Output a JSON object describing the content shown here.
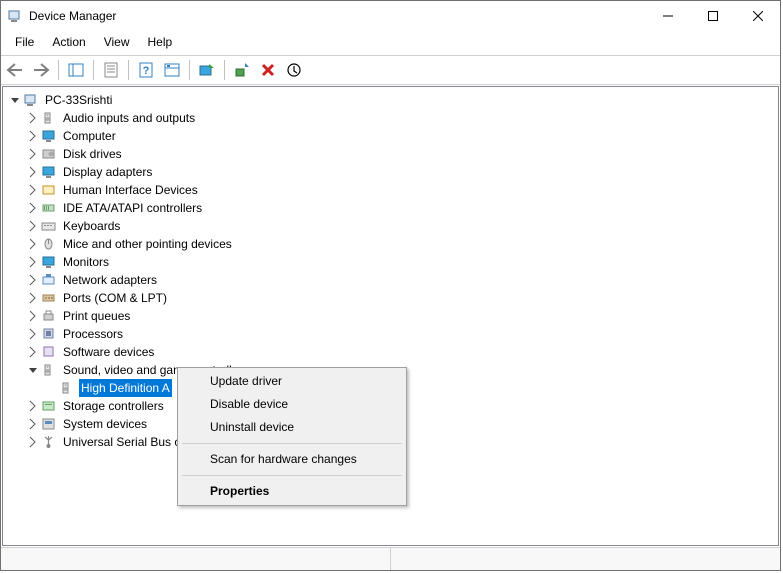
{
  "titlebar": {
    "title": "Device Manager"
  },
  "menubar": {
    "file": "File",
    "action": "Action",
    "view": "View",
    "help": "Help"
  },
  "tree": {
    "root": {
      "label": "PC-33Srishti"
    },
    "nodes": [
      {
        "id": "audio",
        "label": "Audio inputs and outputs",
        "icon": "speaker"
      },
      {
        "id": "computer",
        "label": "Computer",
        "icon": "monitor"
      },
      {
        "id": "disk",
        "label": "Disk drives",
        "icon": "disk"
      },
      {
        "id": "display",
        "label": "Display adapters",
        "icon": "monitor"
      },
      {
        "id": "hid",
        "label": "Human Interface Devices",
        "icon": "hid"
      },
      {
        "id": "ide",
        "label": "IDE ATA/ATAPI controllers",
        "icon": "ide"
      },
      {
        "id": "keyboards",
        "label": "Keyboards",
        "icon": "keyboard"
      },
      {
        "id": "mice",
        "label": "Mice and other pointing devices",
        "icon": "mouse"
      },
      {
        "id": "monitors",
        "label": "Monitors",
        "icon": "monitor"
      },
      {
        "id": "network",
        "label": "Network adapters",
        "icon": "network"
      },
      {
        "id": "ports",
        "label": "Ports (COM & LPT)",
        "icon": "port"
      },
      {
        "id": "printq",
        "label": "Print queues",
        "icon": "printer"
      },
      {
        "id": "proc",
        "label": "Processors",
        "icon": "cpu"
      },
      {
        "id": "softdev",
        "label": "Software devices",
        "icon": "software"
      },
      {
        "id": "sound",
        "label": "Sound, video and game controllers",
        "icon": "speaker",
        "expanded": true,
        "children": [
          {
            "id": "hda",
            "label": "High Definition A",
            "icon": "speaker",
            "selected": true
          }
        ]
      },
      {
        "id": "storage",
        "label": "Storage controllers",
        "icon": "storage"
      },
      {
        "id": "system",
        "label": "System devices",
        "icon": "system"
      },
      {
        "id": "usb",
        "label": "Universal Serial Bus c",
        "icon": "usb"
      }
    ]
  },
  "context_menu": {
    "update": "Update driver",
    "disable": "Disable device",
    "uninstall": "Uninstall device",
    "scan": "Scan for hardware changes",
    "properties": "Properties"
  }
}
